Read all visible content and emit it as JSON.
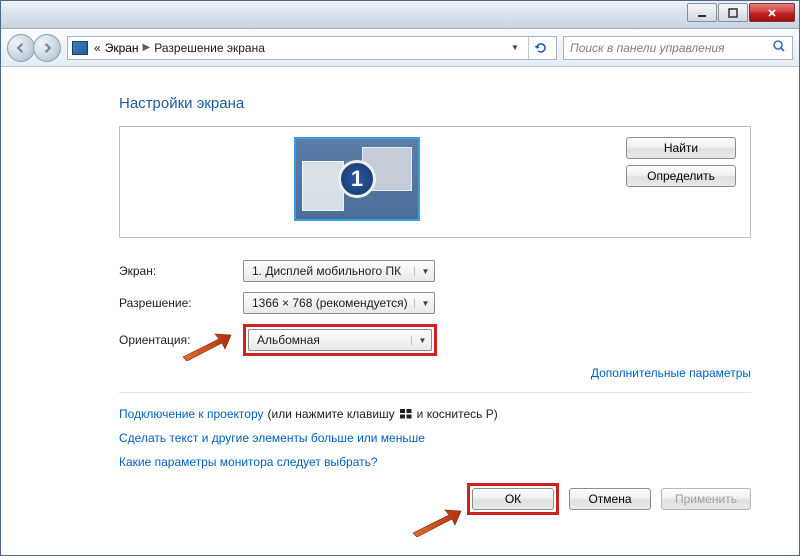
{
  "titlebar": {
    "minimize": "_",
    "maximize": "▢",
    "close": "✕"
  },
  "nav": {
    "crumb_prefix": "«",
    "crumb1": "Экран",
    "crumb2": "Разрешение экрана",
    "search_placeholder": "Поиск в панели управления"
  },
  "page": {
    "title": "Настройки экрана",
    "monitor_number": "1",
    "find_btn": "Найти",
    "detect_btn": "Определить"
  },
  "settings": {
    "display_label": "Экран:",
    "display_value": "1. Дисплей мобильного ПК",
    "resolution_label": "Разрешение:",
    "resolution_value": "1366 × 768 (рекомендуется)",
    "orientation_label": "Ориентация:",
    "orientation_value": "Альбомная"
  },
  "links": {
    "advanced": "Дополнительные параметры",
    "projector_pre": "Подключение к проектору",
    "projector_post1": " (или нажмите клавишу ",
    "projector_post2": " и коснитесь P)",
    "text_size": "Сделать текст и другие элементы больше или меньше",
    "which_monitor": "Какие параметры монитора следует выбрать?"
  },
  "footer": {
    "ok": "ОК",
    "cancel": "Отмена",
    "apply": "Применить"
  }
}
